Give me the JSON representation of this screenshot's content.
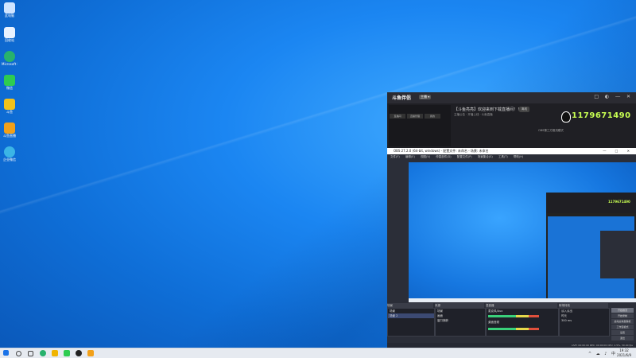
{
  "desktop": {
    "icons": [
      {
        "label": "此电脑",
        "color": "#cfe4ff"
      },
      {
        "label": "回收站",
        "color": "#e8f2ff"
      },
      {
        "label": "Microsoft Edge",
        "color": "#28b26d"
      },
      {
        "label": "微信",
        "color": "#2ecc51"
      },
      {
        "label": "斗鱼",
        "color": "#f2c21a"
      },
      {
        "label": "斗鱼直播",
        "color": "#f0a01a"
      },
      {
        "label": "企业微信",
        "color": "#3bb5e6"
      }
    ]
  },
  "douyu": {
    "logo": "斗鱼伴侣",
    "tag": "主播 ▾",
    "tabs": [
      "直播间",
      "直播管理",
      "我的"
    ],
    "title": "【斗鱼亮亮】欢迎来到下载直播间！！",
    "subtitle": "主播公告 · 开播上线 · 斗鱼直播",
    "status_badge": "离线",
    "qq_number": "1179671490",
    "hint": "OBS第三方推流模式",
    "window_controls": "□ ◐ ― ✕"
  },
  "obs": {
    "title": "OBS 27.2.0 (64-bit, windows) - 配置文件: 未命名 - 场景: 未命名",
    "window_controls": "― □ ✕",
    "menu": [
      "文件(F)",
      "编辑(E)",
      "视图(V)",
      "停靠部件(D)",
      "配置文件(P)",
      "场景集合(S)",
      "工具(T)",
      "帮助(H)"
    ],
    "panels": {
      "scenes": {
        "header": "场景",
        "items": [
          "场景",
          "场景 2"
        ]
      },
      "sources": {
        "header": "来源",
        "items": [
          "场景",
          "画面",
          "窗口捕获"
        ]
      },
      "mixer": {
        "header": "混音器",
        "tracks": [
          {
            "name": "麦克风/Aux",
            "db": "0.0 dB",
            "level": 0.72
          },
          {
            "name": "桌面音频",
            "db": "0.0 dB",
            "level": 0.55
          }
        ]
      },
      "transitions": {
        "header": "转场特效",
        "items": [
          "淡入淡出",
          "时长",
          "300 ms"
        ]
      },
      "controls": {
        "header": "控件",
        "buttons": [
          "开始推流",
          "开始录制",
          "启动虚拟摄像机",
          "工作室模式",
          "设置",
          "退出"
        ]
      }
    },
    "status": "LIVE: 00:00:00  REC: 00:00:00  CPU: 2.5%, 30.00 fps"
  },
  "taskbar": {
    "tray": "^ ☁ ♪ 中",
    "time": "19:32",
    "date": "2021/6/9"
  }
}
